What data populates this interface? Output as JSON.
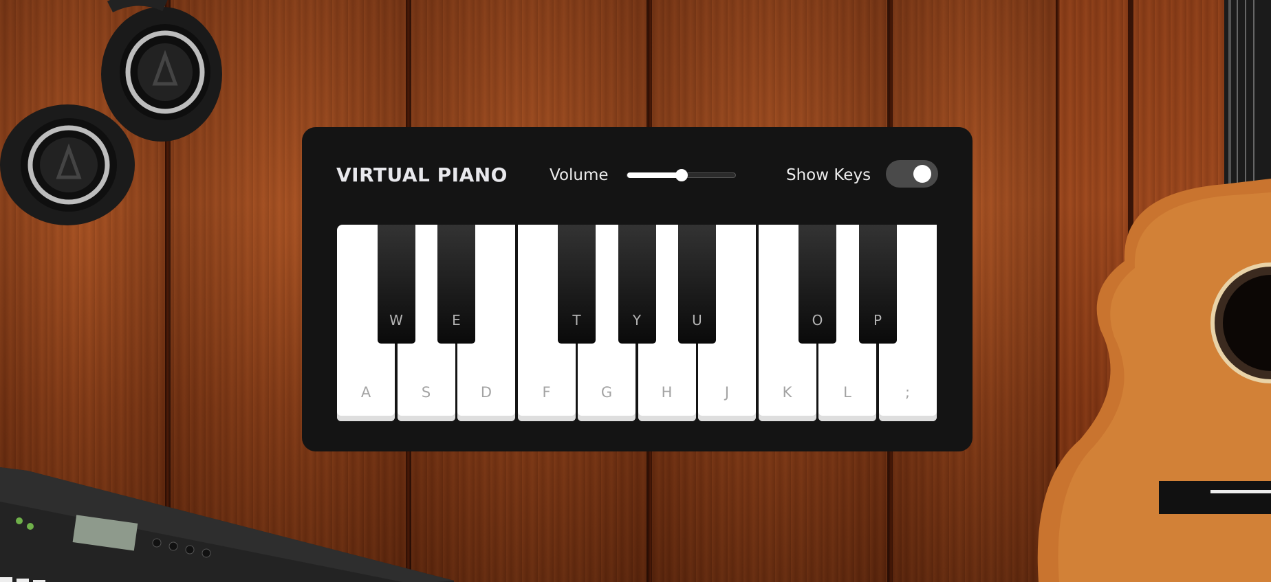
{
  "app": {
    "title": "VIRTUAL PIANO"
  },
  "controls": {
    "volume_label": "Volume",
    "volume_level": 0.5,
    "show_keys_label": "Show Keys",
    "show_keys_on": true
  },
  "keys": {
    "white": [
      "A",
      "S",
      "D",
      "F",
      "G",
      "H",
      "J",
      "K",
      "L",
      ";"
    ],
    "black": [
      "W",
      "E",
      "T",
      "Y",
      "U",
      "O",
      "P"
    ]
  },
  "colors": {
    "panel": "#141414",
    "toggle_track": "#4a4a4a",
    "white_key_label": "#a3a3a3"
  }
}
